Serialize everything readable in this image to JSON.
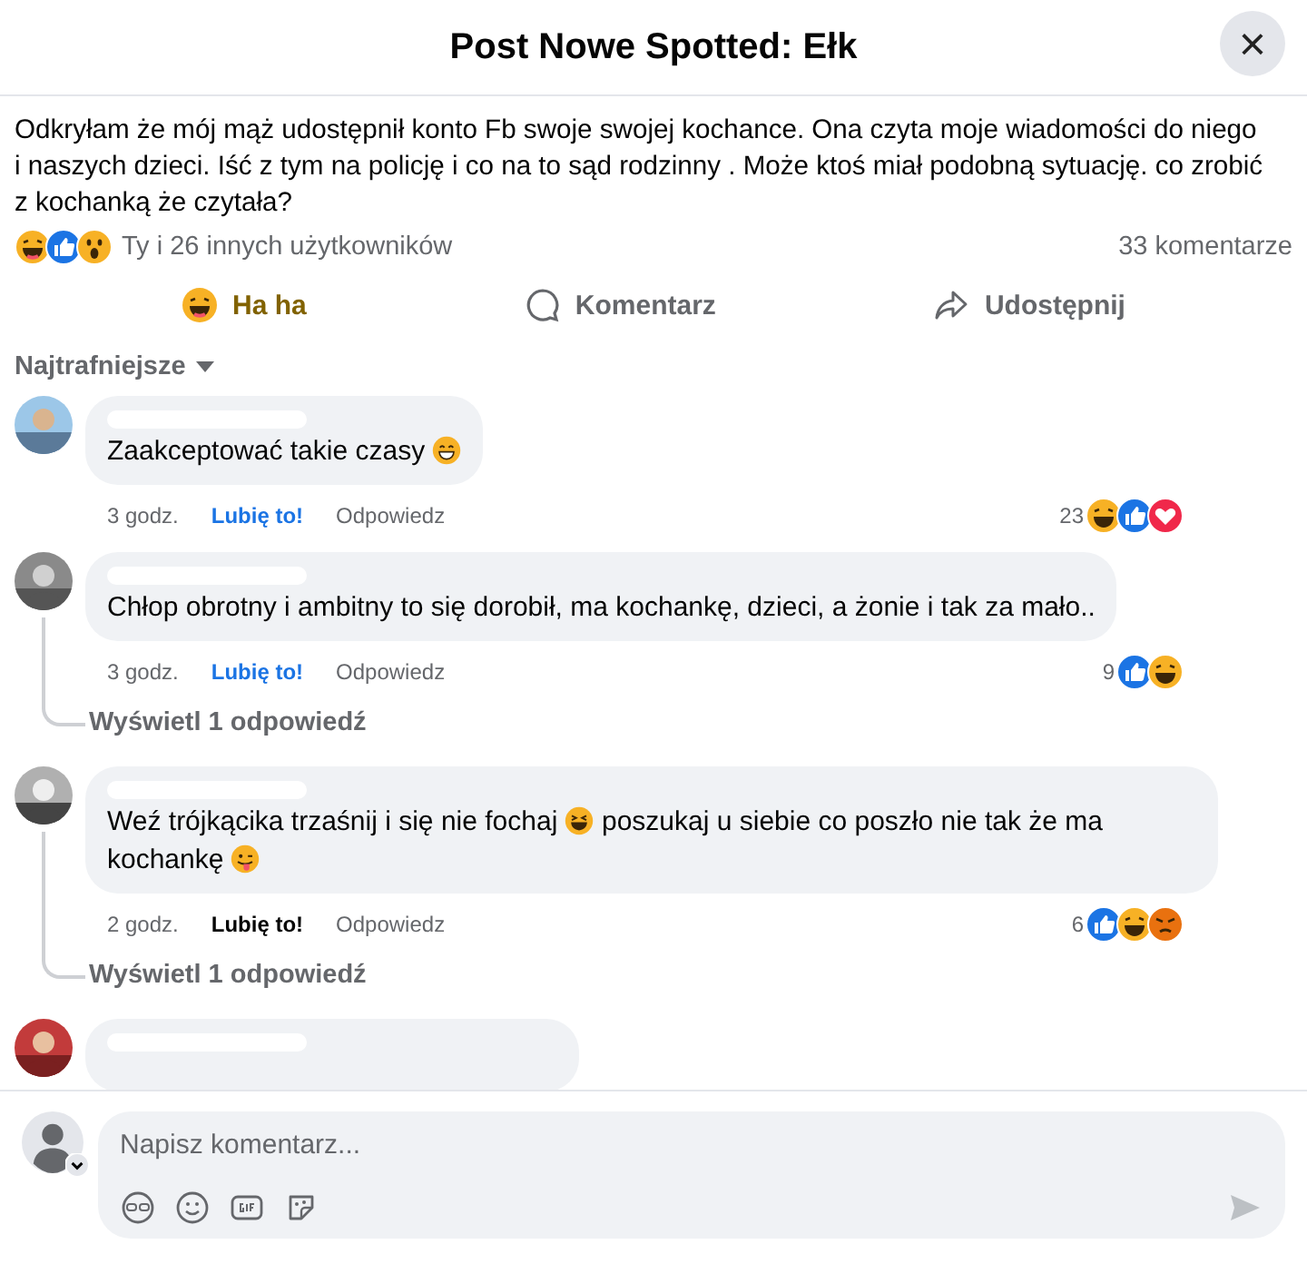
{
  "header": {
    "title": "Post Nowe Spotted: Ełk",
    "close": "×"
  },
  "post": {
    "text": "Odkryłam że mój mąż udostępnił konto Fb swoje swojej kochance. Ona czyta moje wiadomości do niego i naszych dzieci. Iść z tym na policję i co na to sąd rodzinny . Może ktoś miał podobną sytuację. co zrobić z kochanką że czytała?",
    "reactions": [
      {
        "kind": "haha"
      },
      {
        "kind": "like"
      },
      {
        "kind": "wow"
      }
    ],
    "reactions_text": "Ty i 26 innych użytkowników",
    "comments_count": "33 komentarze"
  },
  "actions": [
    {
      "kind": "haha",
      "label": "Ha ha",
      "selected": true
    },
    {
      "kind": "comment",
      "label": "Komentarz",
      "selected": false
    },
    {
      "kind": "share",
      "label": "Udostępnij",
      "selected": false
    }
  ],
  "sort": {
    "label": "Najtrafniejsze"
  },
  "comments": [
    {
      "kind": "full",
      "body": [
        {
          "kind": "text",
          "text": "Zaakceptować takie czasy "
        },
        {
          "kind": "smile"
        }
      ],
      "time": "3 godz.",
      "like": "Lubię to!",
      "liked": true,
      "reply": "Odpowiedz",
      "count": "23",
      "reactions": [
        {
          "kind": "haha"
        },
        {
          "kind": "like"
        },
        {
          "kind": "love"
        }
      ]
    },
    {
      "kind": "full",
      "body": [
        {
          "kind": "text",
          "text": "Chłop obrotny i ambitny to się dorobił, ma kochankę, dzieci, a żonie i tak za mało.."
        }
      ],
      "time": "3 godz.",
      "like": "Lubię to!",
      "liked": true,
      "reply": "Odpowiedz",
      "count": "9",
      "reactions": [
        {
          "kind": "like"
        },
        {
          "kind": "haha"
        }
      ],
      "replies": "Wyświetl 1 odpowiedź"
    },
    {
      "kind": "full",
      "body": [
        {
          "kind": "text",
          "text": "Weź trójkącika trzaśnij i się nie fochaj "
        },
        {
          "kind": "laugh"
        },
        {
          "kind": "text",
          "text": " poszukaj u siebie co poszło nie tak że ma kochankę "
        },
        {
          "kind": "tongue"
        }
      ],
      "time": "2 godz.",
      "like": "Lubię to!",
      "liked": false,
      "reply": "Odpowiedz",
      "count": "6",
      "reactions": [
        {
          "kind": "like"
        },
        {
          "kind": "haha"
        },
        {
          "kind": "angry"
        }
      ],
      "replies": "Wyświetl 1 odpowiedź"
    },
    {
      "kind": "cut"
    }
  ],
  "composer": {
    "placeholder": "Napisz komentarz..."
  }
}
